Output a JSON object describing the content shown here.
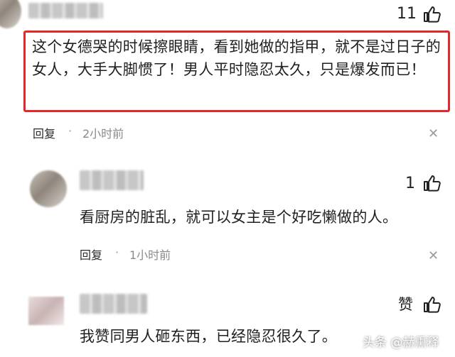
{
  "comments": [
    {
      "likes": "11",
      "text": "这个女德哭的时候擦眼睛，看到她做的指甲，就不是过日子的女人，大手大脚惯了！男人平时隐忍太久，只是爆发而已！",
      "reply_label": "回复",
      "dot": "·",
      "time": "2小时前"
    },
    {
      "likes": "1",
      "text": "看厨房的脏乱，就可以女主是个好吃懒做的人。",
      "reply_label": "回复",
      "dot": "·",
      "time": "1小时前"
    },
    {
      "likes": "赞",
      "text": "我赞同男人砸东西，已经隐忍很久了。"
    }
  ],
  "watermark": "头条 @赫熏释",
  "colors": {
    "highlight": "#e5262b"
  }
}
